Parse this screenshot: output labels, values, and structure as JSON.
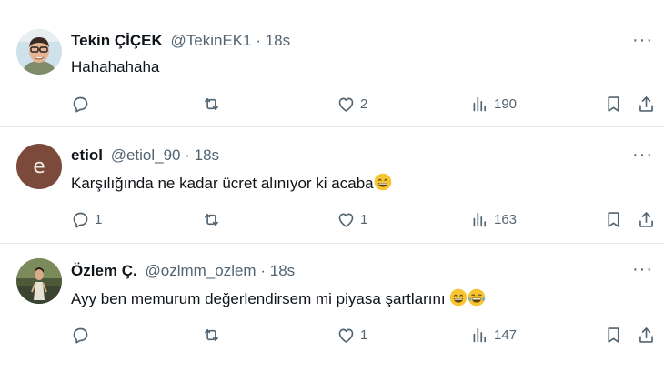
{
  "tweets": [
    {
      "name": "Tekin ÇİÇEK",
      "handle": "@TekinEK1",
      "separator": "·",
      "time": "18s",
      "text": "Hahahahaha",
      "replies": "",
      "retweets": "",
      "likes": "2",
      "views": "190"
    },
    {
      "name": "etiol",
      "handle": "@etiol_90",
      "separator": "·",
      "time": "18s",
      "avatar_letter": "e",
      "text": "Karşılığında ne kadar ücret alınıyor ki acaba",
      "replies": "1",
      "retweets": "",
      "likes": "1",
      "views": "163"
    },
    {
      "name": "Özlem Ç.",
      "handle": "@ozlmm_ozlem",
      "separator": "·",
      "time": "18s",
      "text": "Ayy ben memurum değerlendirsem mi piyasa şartlarını",
      "replies": "",
      "retweets": "",
      "likes": "1",
      "views": "147"
    }
  ],
  "more_label": "···",
  "colors": {
    "text": "#0f1419",
    "secondary": "#536471",
    "divider": "#e6e9eb",
    "etiol_avatar": "#7b4a3a"
  },
  "icons": [
    "reply-icon",
    "retweet-icon",
    "like-icon",
    "views-icon",
    "bookmark-icon",
    "share-icon",
    "more-icon",
    "grinning-face-emoji",
    "tears-of-joy-emoji"
  ]
}
